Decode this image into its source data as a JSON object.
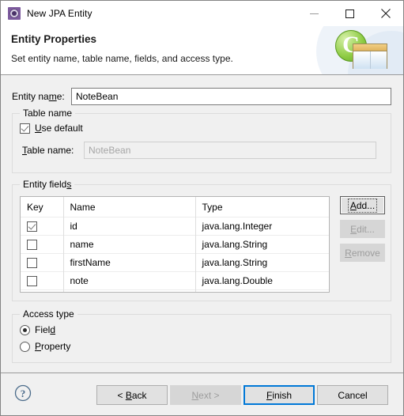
{
  "window": {
    "title": "New JPA Entity",
    "icon": "jpa-entity-icon",
    "controls": {
      "minimize": "minimize-icon",
      "maximize": "maximize-icon",
      "close": "close-icon"
    }
  },
  "banner": {
    "title": "Entity Properties",
    "description": "Set entity name, table name, fields, and access type.",
    "artwork": "jpa-entity-wizard-banner-icon"
  },
  "entity_name": {
    "label_pre": "Entity na",
    "label_mnemonic": "m",
    "label_post": "e:",
    "value": "NoteBean"
  },
  "table_name_group": {
    "legend": "Table name",
    "use_default": {
      "mnemonic": "U",
      "label_rest": "se default",
      "checked": true
    },
    "table_name_field": {
      "label_mnemonic": "T",
      "label_rest": "able name:",
      "value": "NoteBean",
      "enabled": false
    }
  },
  "entity_fields_group": {
    "legend_pre": "Entity field",
    "legend_mnemonic": "s",
    "columns": [
      "Key",
      "Name",
      "Type"
    ],
    "rows": [
      {
        "key": true,
        "name": "id",
        "type": "java.lang.Integer"
      },
      {
        "key": false,
        "name": "name",
        "type": "java.lang.String"
      },
      {
        "key": false,
        "name": "firstName",
        "type": "java.lang.String"
      },
      {
        "key": false,
        "name": "note",
        "type": "java.lang.Double"
      }
    ],
    "buttons": [
      {
        "label": "Add...",
        "mnemonic": "A",
        "rest": "dd...",
        "enabled": true,
        "focused": true
      },
      {
        "label": "Edit...",
        "mnemonic": "E",
        "rest": "dit...",
        "enabled": false,
        "focused": false
      },
      {
        "label": "Remove",
        "mnemonic": "R",
        "rest": "emove",
        "enabled": false,
        "focused": false
      }
    ]
  },
  "access_type_group": {
    "legend": "Access type",
    "options": [
      {
        "pre": "Fiel",
        "mnemonic": "d",
        "post": "",
        "selected": true
      },
      {
        "pre": "",
        "mnemonic": "P",
        "post": "roperty",
        "selected": false
      }
    ]
  },
  "footer": {
    "help": "help-icon",
    "buttons": [
      {
        "pre": "< ",
        "mnemonic": "B",
        "post": "ack",
        "enabled": true,
        "default": false
      },
      {
        "pre": "",
        "mnemonic": "N",
        "post": "ext >",
        "enabled": false,
        "default": false
      },
      {
        "pre": "",
        "mnemonic": "F",
        "post": "inish",
        "enabled": true,
        "default": true
      },
      {
        "pre": "",
        "mnemonic": "",
        "post": "Cancel",
        "enabled": true,
        "default": false
      }
    ]
  },
  "colors": {
    "accent_blue": "#0078d7",
    "dialog_bg": "#f0f0f0",
    "banner_bg": "#ffffff"
  }
}
